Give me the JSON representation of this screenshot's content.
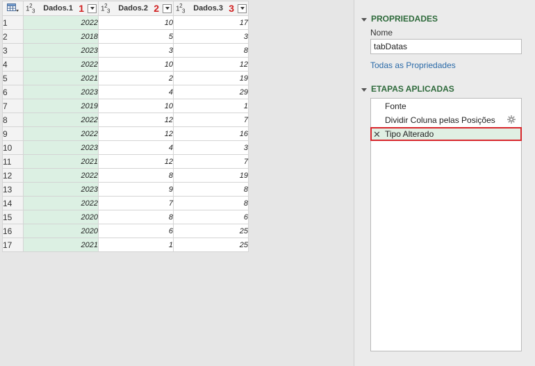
{
  "table": {
    "columns": [
      {
        "type_icon": "123",
        "name": "Dados.1",
        "number": "1"
      },
      {
        "type_icon": "123",
        "name": "Dados.2",
        "number": "2"
      },
      {
        "type_icon": "123",
        "name": "Dados.3",
        "number": "3"
      }
    ],
    "rows": [
      {
        "n": "1",
        "c1": "2022",
        "c2": "10",
        "c3": "17"
      },
      {
        "n": "2",
        "c1": "2018",
        "c2": "5",
        "c3": "3"
      },
      {
        "n": "3",
        "c1": "2023",
        "c2": "3",
        "c3": "8"
      },
      {
        "n": "4",
        "c1": "2022",
        "c2": "10",
        "c3": "12"
      },
      {
        "n": "5",
        "c1": "2021",
        "c2": "2",
        "c3": "19"
      },
      {
        "n": "6",
        "c1": "2023",
        "c2": "4",
        "c3": "29"
      },
      {
        "n": "7",
        "c1": "2019",
        "c2": "10",
        "c3": "1"
      },
      {
        "n": "8",
        "c1": "2022",
        "c2": "12",
        "c3": "7"
      },
      {
        "n": "9",
        "c1": "2022",
        "c2": "12",
        "c3": "16"
      },
      {
        "n": "10",
        "c1": "2023",
        "c2": "4",
        "c3": "3"
      },
      {
        "n": "11",
        "c1": "2021",
        "c2": "12",
        "c3": "7"
      },
      {
        "n": "12",
        "c1": "2022",
        "c2": "8",
        "c3": "19"
      },
      {
        "n": "13",
        "c1": "2023",
        "c2": "9",
        "c3": "8"
      },
      {
        "n": "14",
        "c1": "2022",
        "c2": "7",
        "c3": "8"
      },
      {
        "n": "15",
        "c1": "2020",
        "c2": "8",
        "c3": "6"
      },
      {
        "n": "16",
        "c1": "2020",
        "c2": "6",
        "c3": "25"
      },
      {
        "n": "17",
        "c1": "2021",
        "c2": "1",
        "c3": "25"
      }
    ]
  },
  "properties": {
    "title": "PROPRIEDADES",
    "name_label": "Nome",
    "name_value": "tabDatas",
    "all_properties_link": "Todas as Propriedades"
  },
  "applied_steps": {
    "title": "ETAPAS APLICADAS",
    "steps": [
      {
        "label": "Fonte"
      },
      {
        "label": "Dividir Coluna pelas Posições"
      },
      {
        "label": "Tipo Alterado"
      }
    ]
  },
  "colors": {
    "accent_green": "#2e6a3b",
    "selected_column": "#dcf0e3",
    "highlight_red": "#d8262c",
    "link_blue": "#2a6aa8"
  },
  "icons": {
    "table_corner": "table-menu-icon",
    "column_type": "whole-number-type-icon",
    "step_settings": "gear-icon",
    "step_delete": "delete-step-icon"
  }
}
